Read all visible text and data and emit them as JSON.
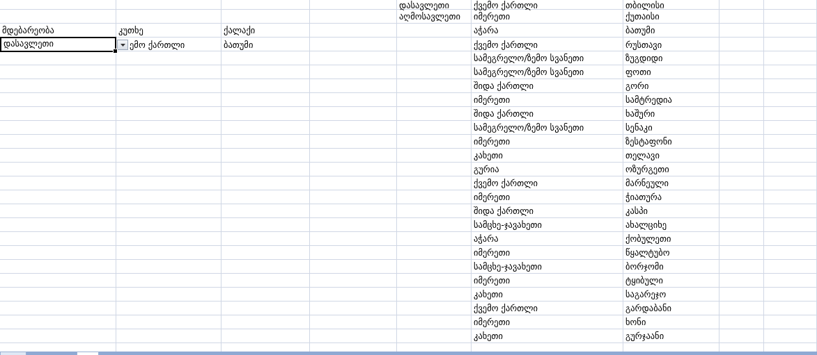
{
  "input_table": {
    "headers": [
      "მდებარეობა",
      "კუთხე",
      "ქალაქი"
    ],
    "row": [
      {
        "text": "დასავლეთი",
        "selected": true
      },
      {
        "text": "ემო ქართლი",
        "selected": false
      },
      {
        "text": "ბათუმი",
        "selected": false
      }
    ]
  },
  "directions": [
    "დასავლეთი",
    "აღმოსავლეთი"
  ],
  "regions_table": [
    {
      "region": "ქვემო ქართლი",
      "city": "თბილისი"
    },
    {
      "region": "იმერეთი",
      "city": "ქუთაისი"
    },
    {
      "region": "აჭარა",
      "city": "ბათუმი"
    },
    {
      "region": "ქვემო ქართლი",
      "city": "რუსთავი"
    },
    {
      "region": "სამეგრელო/ზემო სვანეთი",
      "city": "ზუგდიდი"
    },
    {
      "region": "სამეგრელო/ზემო სვანეთი",
      "city": "ფოთი"
    },
    {
      "region": "შიდა ქართლი",
      "city": "გორი"
    },
    {
      "region": "იმერეთი",
      "city": "სამტრედია"
    },
    {
      "region": "შიდა ქართლი",
      "city": "ხაშური"
    },
    {
      "region": "სამეგრელო/ზემო სვანეთი",
      "city": "სენაკი"
    },
    {
      "region": "იმერეთი",
      "city": "ზესტაფონი"
    },
    {
      "region": "კახეთი",
      "city": "თელავი"
    },
    {
      "region": "გურია",
      "city": "ოზურგეთი"
    },
    {
      "region": "ქვემო ქართლი",
      "city": "მარნეული"
    },
    {
      "region": "იმერეთი",
      "city": "ჭიათურა"
    },
    {
      "region": "შიდა ქართლი",
      "city": "კასპი"
    },
    {
      "region": "სამცხე-ჯავახეთი",
      "city": "ახალციხე"
    },
    {
      "region": "აჭარა",
      "city": "ქობულეთი"
    },
    {
      "region": "იმერეთი",
      "city": "წყალტუბო"
    },
    {
      "region": "სამცხე-ჯავახეთი",
      "city": "ბორჯომი"
    },
    {
      "region": "იმერეთი",
      "city": "ტყიბული"
    },
    {
      "region": "კახეთი",
      "city": "საგარეჯო"
    },
    {
      "region": "ქვემო ქართლი",
      "city": "გარდაბანი"
    },
    {
      "region": "იმერეთი",
      "city": "ხონი"
    },
    {
      "region": "კახეთი",
      "city": "გურჯაანი"
    }
  ]
}
